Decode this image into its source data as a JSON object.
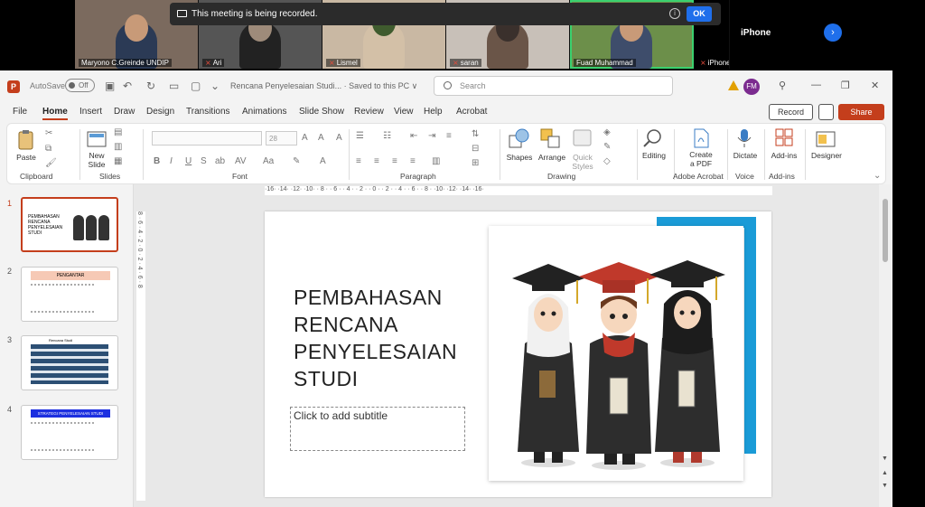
{
  "meeting": {
    "recording_banner": "This meeting is being recorded.",
    "ok_label": "OK",
    "next_label": "›",
    "iphone_label": "iPhone",
    "participants": [
      {
        "name": "Maryono C.Greinde UNDIP",
        "muted": false
      },
      {
        "name": "Ari",
        "muted": true
      },
      {
        "name": "Lismel",
        "muted": true
      },
      {
        "name": "saran",
        "muted": true
      },
      {
        "name": "Fuad Muhammad",
        "muted": false,
        "active": true
      },
      {
        "name": "iPhone",
        "muted": true
      }
    ]
  },
  "powerpoint": {
    "app_icon": "P",
    "autosave_label": "AutoSave",
    "autosave_state": "Off",
    "doc_name": "Rencana Penyelesaian Studi... · Saved to this PC ∨",
    "search_placeholder": "Search",
    "user_initials": "FM",
    "tabs": [
      "File",
      "Home",
      "Insert",
      "Draw",
      "Design",
      "Transitions",
      "Animations",
      "Slide Show",
      "Review",
      "View",
      "Help",
      "Acrobat"
    ],
    "active_tab": "Home",
    "record_label": "Record",
    "share_label": "Share",
    "ribbon": {
      "paste": "Paste",
      "new_slide": "New\nSlide",
      "font_size": "28",
      "shapes": "Shapes",
      "arrange": "Arrange",
      "quick_styles": "Quick\nStyles",
      "editing": "Editing",
      "create_pdf": "Create\na PDF",
      "dictate": "Dictate",
      "add_ins": "Add-ins",
      "designer": "Designer",
      "groups": [
        "Clipboard",
        "Slides",
        "Font",
        "Paragraph",
        "Drawing",
        "Adobe Acrobat",
        "Voice",
        "Add-ins"
      ]
    },
    "ruler_h": "·16· ·14· ·12· ·10· · 8 · · 6 · · 4 · · 2 · · 0 · · 2 · · 4 · · 6 · · 8 · ·10· ·12· ·14· ·16·",
    "ruler_v": "8 · 6 · 4 · 2 · 0 · 2 · 4 · 6 · 8",
    "slides": [
      {
        "num": "1",
        "title": "PEMBAHASAN RENCANA PENYELESAIAN STUDI",
        "selected": true
      },
      {
        "num": "2",
        "title": "PENGANTAR"
      },
      {
        "num": "3",
        "title": "Rencana Studi"
      },
      {
        "num": "4",
        "title": "STRATEGI PENYELESAIAN STUDI"
      }
    ],
    "current_slide": {
      "title_lines": [
        "PEMBAHASAN",
        "RENCANA",
        "PENYELESAIAN",
        "STUDI"
      ],
      "subtitle_placeholder": "Click to add subtitle"
    }
  },
  "colors": {
    "accent": "#c43e1c",
    "slide_blue": "#1a9bd7",
    "meeting_blue": "#1f6feb"
  }
}
